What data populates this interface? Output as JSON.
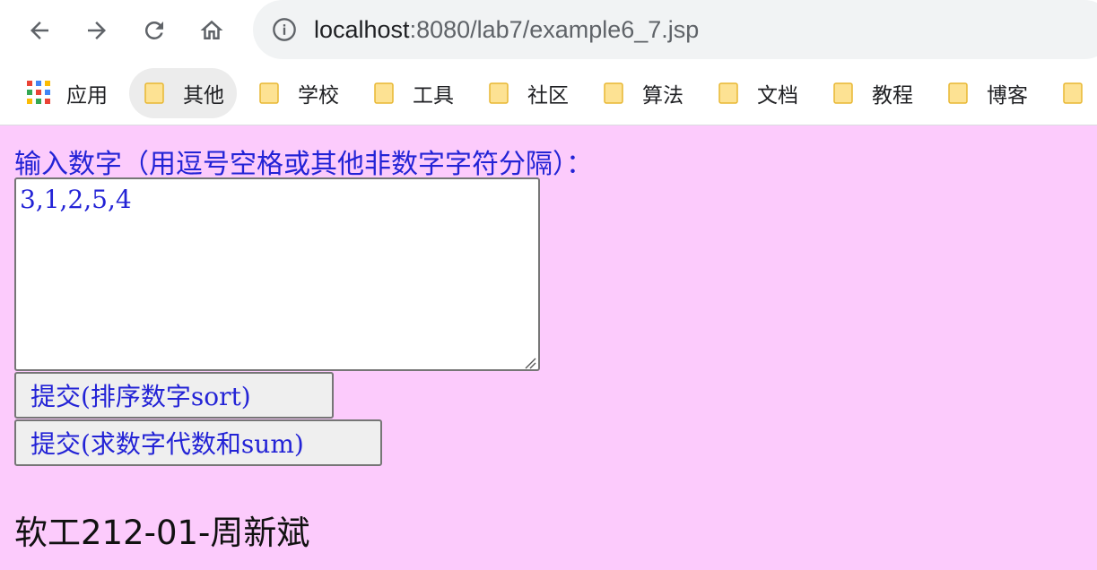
{
  "browser": {
    "url_host": "localhost",
    "url_path": ":8080/lab7/example6_7.jsp",
    "bookmarks": {
      "apps_label": "应用",
      "items": [
        "其他",
        "学校",
        "工具",
        "社区",
        "算法",
        "文档",
        "教程",
        "博客"
      ]
    },
    "colors": {
      "folder_fill": "#fde293",
      "folder_stroke": "#e8b732"
    }
  },
  "page": {
    "background": "#fccbfc",
    "prompt": "输入数字（用逗号空格或其他非数字字符分隔）：",
    "numbers_value": "3,1,2,5,4",
    "sort_button_label": "提交(排序数字sort)",
    "sum_button_label": "提交(求数字代数和sum)",
    "footer_name": "软工212-01-周新斌",
    "text_color": "#2323d6"
  }
}
